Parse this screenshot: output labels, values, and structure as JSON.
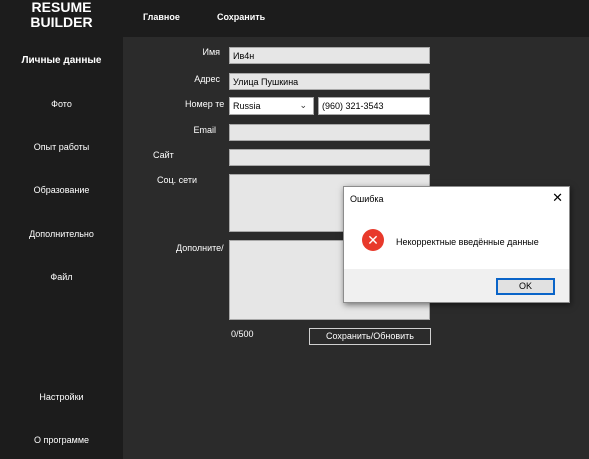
{
  "app": {
    "logo": "RESUME\nBUILDER"
  },
  "topbar": {
    "home": "Главное",
    "save": "Сохранить"
  },
  "sidebar": {
    "items": [
      {
        "label": "Личные данные"
      },
      {
        "label": "Фото"
      },
      {
        "label": "Опыт работы"
      },
      {
        "label": "Образование"
      },
      {
        "label": "Дополнительно"
      },
      {
        "label": "Файл"
      },
      {
        "label": "Настройки"
      },
      {
        "label": "О программе"
      }
    ]
  },
  "form": {
    "name_label": "Имя",
    "name_value": "Ив4н",
    "address_label": "Адрес",
    "address_value": "Улица Пушкина",
    "phone_label": "Номер те",
    "country_value": "Russia",
    "phone_value": "(960) 321-3543",
    "email_label": "Email",
    "email_value": "",
    "site_label": "Сайт",
    "site_value": "",
    "social_label": "Соц. сети",
    "social_value": "",
    "extra_label": "Дополните/",
    "extra_value": "",
    "counter": "0/500",
    "save_update": "Сохранить/Обновить"
  },
  "dialog": {
    "title": "Ошибка",
    "close": "✕",
    "message": "Некорректные введённые данные",
    "ok": "OK",
    "icon": "error-icon"
  }
}
